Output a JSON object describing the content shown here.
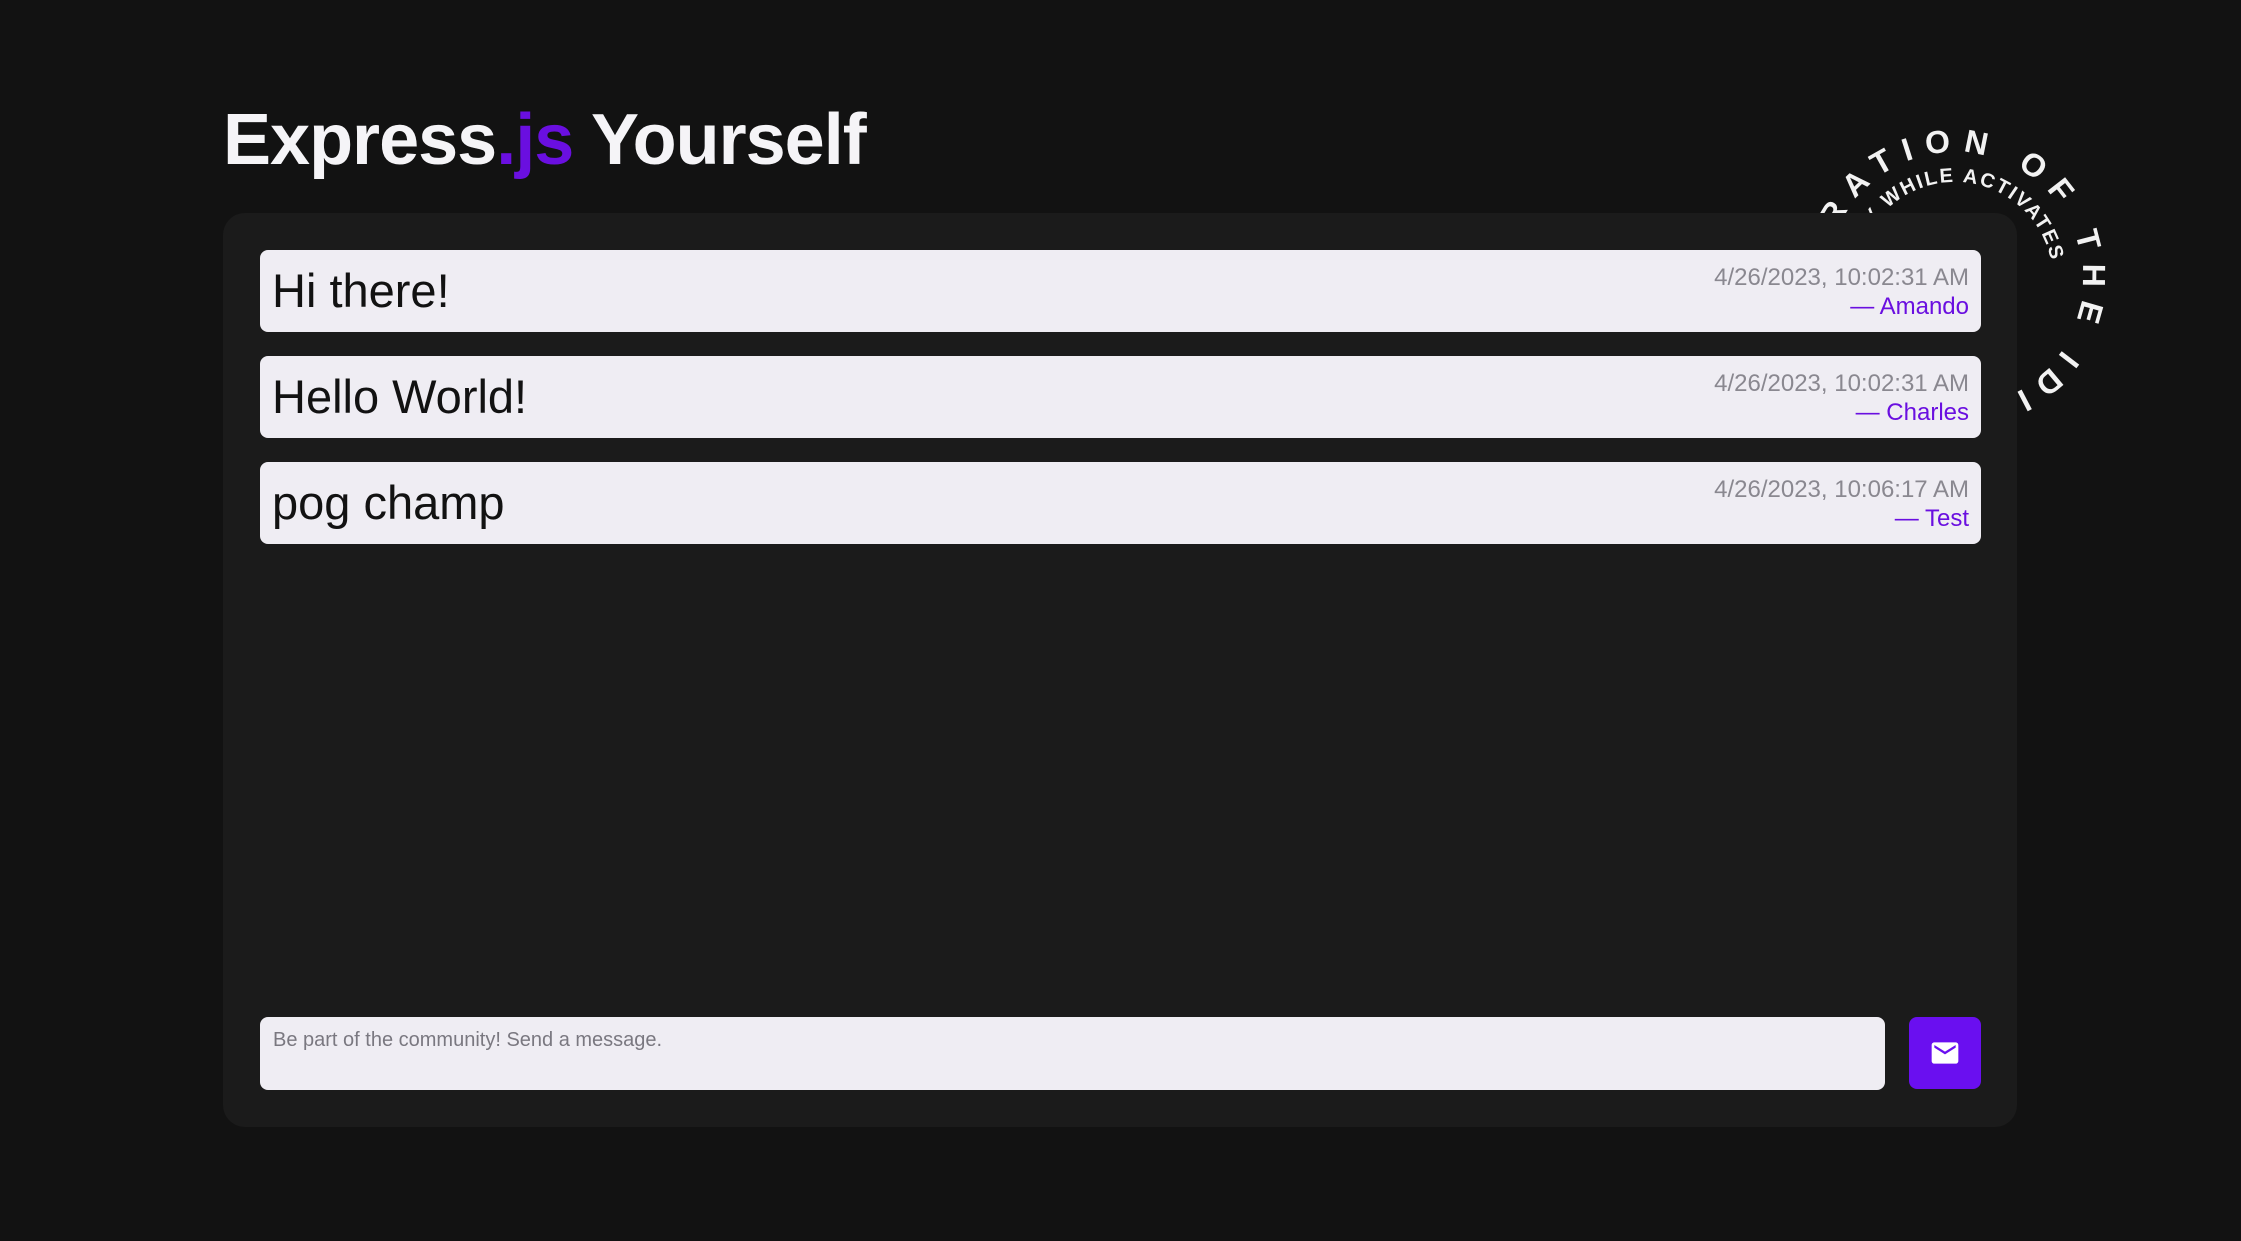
{
  "header": {
    "title_part1": "Express",
    "title_accent": ".js",
    "title_part2": " Yourself"
  },
  "badge": {
    "outer_text": "ADMIRATION OF THE IDIOT AN ENTITY",
    "inner_text": "SIMPLICITY WHILE ACTIVATES"
  },
  "messages": [
    {
      "text": "Hi there!",
      "time": "4/26/2023, 10:02:31 AM",
      "author": "— Amando"
    },
    {
      "text": "Hello World!",
      "time": "4/26/2023, 10:02:31 AM",
      "author": "— Charles"
    },
    {
      "text": "pog champ",
      "time": "4/26/2023, 10:06:17 AM",
      "author": "— Test"
    }
  ],
  "composer": {
    "placeholder": "Be part of the community! Send a message.",
    "value": ""
  },
  "send_button": {
    "icon": "mail-icon"
  },
  "colors": {
    "background": "#121212",
    "panel": "#1b1b1b",
    "card": "#efedf3",
    "accent": "#6a0fe0",
    "timestamp": "#8a8890"
  }
}
